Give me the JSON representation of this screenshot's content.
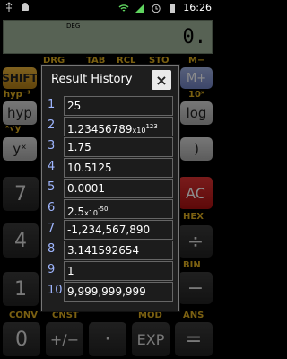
{
  "status": {
    "time": "16:26"
  },
  "display": {
    "mode": "DEG",
    "value": "0."
  },
  "function_labels": {
    "drg": "DRG",
    "tab": "TAB",
    "rcl": "RCL",
    "sto": "STO",
    "mminus": "M−",
    "hyp_inv": "hyp⁻¹",
    "tenx": "10ˣ",
    "sqrtx": "ˣ√y",
    "hex": "HEX",
    "bin": "BIN",
    "conv": "CONV",
    "cnst": "CNST",
    "mod": "MOD",
    "ans": "ANS"
  },
  "keys": {
    "shift": "SHIFT",
    "mplus": "M+",
    "hyp": "hyp",
    "log": "log",
    "yx": "yˣ",
    "rparen": ")",
    "seven": "7",
    "four": "4",
    "one": "1",
    "zero": "0",
    "ac": "AC",
    "divide": "÷",
    "minus": "−",
    "plusminus": "+∕−",
    "dot": "·",
    "exp": "EXP",
    "equals": "="
  },
  "history": {
    "title": "Result History",
    "close": "×",
    "items": [
      {
        "n": "1",
        "value": "25"
      },
      {
        "n": "2",
        "value": "1.23456789",
        "exp": "123"
      },
      {
        "n": "3",
        "value": "1.75"
      },
      {
        "n": "4",
        "value": "10.5125"
      },
      {
        "n": "5",
        "value": "0.0001"
      },
      {
        "n": "6",
        "value": "2.5",
        "exp": "-50"
      },
      {
        "n": "7",
        "value": "-1,234,567,890"
      },
      {
        "n": "8",
        "value": "3.141592654"
      },
      {
        "n": "9",
        "value": "1"
      },
      {
        "n": "10",
        "value": "9,999,999,999"
      }
    ]
  }
}
